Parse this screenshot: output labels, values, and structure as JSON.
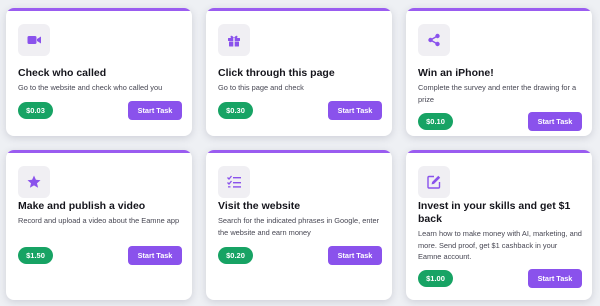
{
  "tasks": [
    {
      "icon": "video-camera-icon",
      "title": "Check who called",
      "desc": "Go to the website and check who called you",
      "price": "$0.03",
      "button": "Start Task"
    },
    {
      "icon": "gift-icon",
      "title": "Click through this page",
      "desc": "Go to this page and check",
      "price": "$0.30",
      "button": "Start Task"
    },
    {
      "icon": "share-icon",
      "title": "Win an iPhone!",
      "desc": "Complete the survey and enter the drawing for a prize",
      "price": "$0.10",
      "button": "Start Task"
    },
    {
      "icon": "star-icon",
      "title": "Make and publish a video",
      "desc": "Record and upload a video about the Eamne app",
      "price": "$1.50",
      "button": "Start Task"
    },
    {
      "icon": "checklist-icon",
      "title": "Visit the website",
      "desc": "Search for the indicated phrases in Google, enter the website and earn money",
      "price": "$0.20",
      "button": "Start Task"
    },
    {
      "icon": "edit-icon",
      "title": "Invest in your skills and get $1 back",
      "desc": "Learn how to make money with AI, marketing, and more. Send proof, get $1 cashback in your Eamne account.",
      "price": "$1.00",
      "button": "Start Task"
    }
  ],
  "colors": {
    "accent": "#8a52ec",
    "price": "#17a364",
    "icon": "#8a52ec"
  }
}
